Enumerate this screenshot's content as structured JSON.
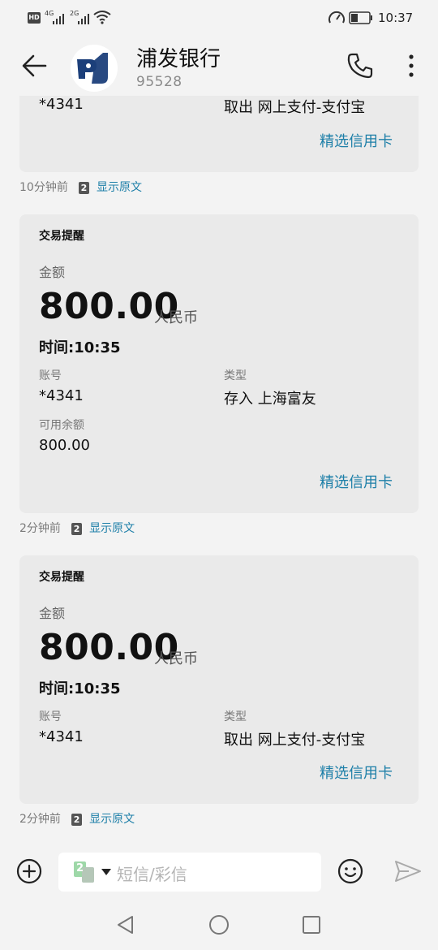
{
  "status": {
    "hd": "HD",
    "net1": "4G",
    "net2": "2G",
    "battery_text": "10:37"
  },
  "header": {
    "title": "浦发银行",
    "number": "95528"
  },
  "top_card": {
    "account": "*4341",
    "type": "取出 网上支付-支付宝",
    "link": "精选信用卡"
  },
  "meta1": {
    "time": "10分钟前",
    "badge": "2",
    "show_original": "显示原文"
  },
  "card2": {
    "title": "交易提醒",
    "amount_label": "金额",
    "amount": "800.00",
    "currency": "人民币",
    "time": "时间:10:35",
    "account_label": "账号",
    "account": "*4341",
    "type_label": "类型",
    "type": "存入 上海富友",
    "balance_label": "可用余额",
    "balance": "800.00",
    "link": "精选信用卡"
  },
  "meta2": {
    "time": "2分钟前",
    "badge": "2",
    "show_original": "显示原文"
  },
  "card3": {
    "title": "交易提醒",
    "amount_label": "金额",
    "amount": "800.00",
    "currency": "人民币",
    "time": "时间:10:35",
    "account_label": "账号",
    "account": "*4341",
    "type_label": "类型",
    "type": "取出 网上支付-支付宝",
    "link": "精选信用卡"
  },
  "meta3": {
    "time": "2分钟前",
    "badge": "2",
    "show_original": "显示原文"
  },
  "composer": {
    "placeholder": "短信/彩信",
    "sim_label": "2"
  },
  "icons": {
    "back": "arrow-left-icon",
    "phone": "phone-icon",
    "more": "more-vertical-icon",
    "add": "plus-circle-icon",
    "emoji": "smiley-icon",
    "send": "send-icon"
  },
  "colors": {
    "accent": "#1d7fa8",
    "card_bg": "#eaeaea",
    "page_bg": "#f3f3f3"
  }
}
